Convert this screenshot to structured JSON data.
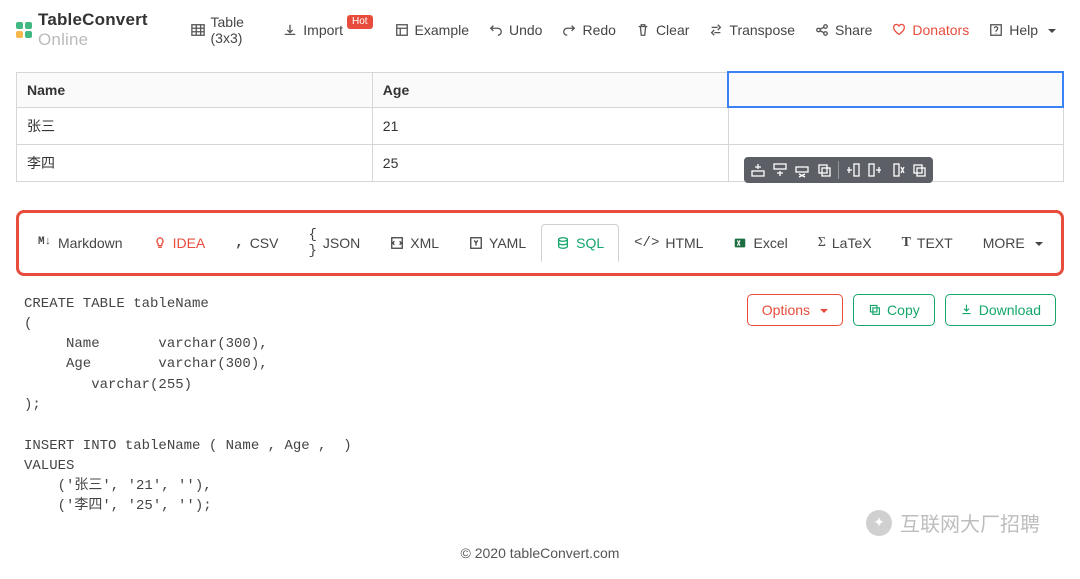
{
  "brand": {
    "name": "TableConvert",
    "suffix": "Online"
  },
  "nav": {
    "table": "Table (3x3)",
    "import": "Import",
    "import_badge": "Hot",
    "example": "Example",
    "undo": "Undo",
    "redo": "Redo",
    "clear": "Clear",
    "transpose": "Transpose",
    "share": "Share",
    "donators": "Donators",
    "help": "Help"
  },
  "table": {
    "headers": [
      "Name",
      "Age",
      ""
    ],
    "rows": [
      [
        "张三",
        "21",
        ""
      ],
      [
        "李四",
        "25",
        ""
      ]
    ]
  },
  "cell_toolbar": {
    "add_row_above": "add-row-above",
    "add_row_below": "add-row-below",
    "delete_row": "delete-row",
    "copy_row": "copy-row",
    "add_col_left": "add-col-left",
    "add_col_right": "add-col-right",
    "delete_col": "delete-col",
    "copy_col": "copy-col"
  },
  "tabs": {
    "markdown": "Markdown",
    "idea": "IDEA",
    "csv": "CSV",
    "json": "JSON",
    "xml": "XML",
    "yaml": "YAML",
    "sql": "SQL",
    "html": "HTML",
    "excel": "Excel",
    "latex": "LaTeX",
    "text": "TEXT",
    "more": "MORE"
  },
  "output": {
    "options": "Options",
    "copy": "Copy",
    "download": "Download",
    "code": "CREATE TABLE tableName\n(\n     Name       varchar(300),\n     Age        varchar(300),\n        varchar(255)\n);\n\nINSERT INTO tableName ( Name , Age ,  )\nVALUES\n    ('张三', '21', ''),\n    ('李四', '25', '');"
  },
  "footer": "© 2020 tableConvert.com",
  "watermark": "互联网大厂招聘"
}
